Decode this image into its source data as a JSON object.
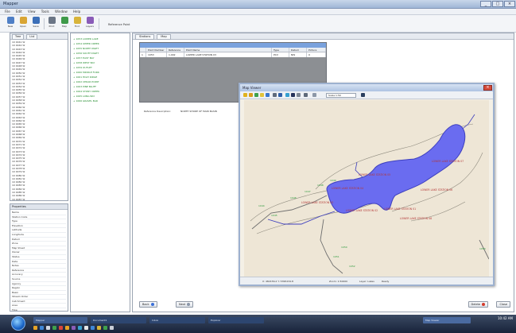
{
  "window": {
    "title": "Mapper",
    "buttons": [
      "_",
      "□",
      "×"
    ]
  },
  "menu": [
    "File",
    "Edit",
    "View",
    "Tools",
    "Window",
    "Help"
  ],
  "toolbar": {
    "buttons": [
      {
        "label": "New",
        "icon": "new-icon",
        "color": "#4f7fc6"
      },
      {
        "label": "Open",
        "icon": "open-icon",
        "color": "#d9a534"
      },
      {
        "label": "Save",
        "icon": "save-icon",
        "color": "#3c6fb8"
      },
      {
        "label": "Print",
        "icon": "print-icon",
        "color": "#6b7686"
      },
      {
        "label": "Map",
        "icon": "map-icon",
        "color": "#3f9a4a"
      },
      {
        "label": "Find",
        "icon": "find-icon",
        "color": "#d8b43a"
      },
      {
        "label": "Layers",
        "icon": "layers-icon",
        "color": "#8a5cb8"
      }
    ],
    "extra_label": "Reference Point"
  },
  "left_tree": {
    "tabs": [
      "Tree",
      "List"
    ],
    "items": [
      "10 0041 W",
      "10 0042 W",
      "10 0043 W",
      "10 0044 W",
      "10 0045 W",
      "10 0046 W",
      "10 0047 W",
      "10 0048 W",
      "10 0049 W",
      "10 0050 W",
      "10 0051 W",
      "10 0052 W",
      "10 0053 W",
      "10 0054 W",
      "10 0055 W",
      "10 0056 W",
      "10 0057 W",
      "10 0058 W",
      "10 0059 W",
      "10 0060 W",
      "10 0061 W",
      "10 0062 W",
      "10 0063 W",
      "10 0064 W",
      "10 0065 W",
      "10 0066 W",
      "10 0067 W",
      "10 0068 W",
      "10 0069 W",
      "10 0070 W",
      "10 0071 W",
      "10 0072 W",
      "10 0073 W",
      "10 0074 W",
      "10 0075 W",
      "10 0076 W",
      "10 0077 W",
      "10 0078 W",
      "10 0079 W",
      "10 0080 W",
      "10 0081 W",
      "10 0082 W",
      "10 0083 W",
      "10 0084 W",
      "10 0085 W",
      "10 0086 W",
      "10 0087 W",
      "10 0088 W"
    ],
    "selected_index": 47
  },
  "left_props": {
    "title": "Properties",
    "items": [
      "Name",
      "Station Code",
      "Type",
      "Elevation",
      "Latitude",
      "Longitude",
      "Datum",
      "Zone",
      "Map Sheet",
      "Owner",
      "Status",
      "Date",
      "Notes",
      "Reference",
      "Accuracy",
      "Source",
      "Agency",
      "Region",
      "Basin",
      "Stream Order",
      "Catchment",
      "Area",
      "Flow",
      "Gauge"
    ]
  },
  "green_list": {
    "items": [
      "+ 1053 LOWER LAKE",
      "+ 1054 UPPER CREEK",
      "+ 1055 NORTH INLET",
      "+ 1056 SOUTH INLET",
      "+ 1057 EAST BAY",
      "+ 1058 WEST BAY",
      "+ 1059 OUTLET",
      "+ 1060 MIDDLE FORK",
      "+ 1061 HIGH RIDGE",
      "+ 1062 CEDAR POINT",
      "+ 1063 PINE BLUFF",
      "+ 1064 STONY CREEK",
      "+ 1065 LONG BAY",
      "+ 1066 GRAVEL BAR"
    ]
  },
  "main": {
    "tabs": [
      "Stations",
      "Map"
    ],
    "grid": {
      "columns": [
        "",
        "Point Number",
        "Reference",
        "Point Name",
        "Type",
        "Datum",
        "Picture"
      ],
      "rows": [
        [
          "1",
          "1053",
          "1,002",
          "LOWER LAKE STATION 03",
          "PCV",
          "NW",
          "0"
        ]
      ]
    },
    "reference_label": "Reference Description:",
    "reference_value": "NORTH SHORE OF MAIN BASIN",
    "bottom_left_buttons": [
      "Back",
      "Next"
    ],
    "bottom_right_buttons": [
      "Delete",
      "Close"
    ]
  },
  "map_window": {
    "title": "Map Viewer",
    "close": "×",
    "combo_value": "Scale 1:50",
    "status": [
      "X: 482156.2 Y: 5395234.8",
      "Zoom: 1:50000",
      "Layer: Lakes",
      "Ready"
    ],
    "colors": {
      "lake": "#6a6cf0",
      "lake_outline": "#3d3fbe",
      "water_line": "#3d3fbe",
      "road": "#6f6f6f",
      "contour": "#8e8a7e",
      "label": "#b33636",
      "marker": "#2b9a3b",
      "canvas": "#eee6d6"
    },
    "labels": [
      "LOWER LAKE STATION 07",
      "LOWER LAKE STATION 05",
      "LOWER LAKE STATION 04",
      "LOWER LAKE STATION 03",
      "LOWER LAKE STATION 02",
      "LOWER LAKE STATION 01",
      "LOWER LAKE STATION 06",
      "LOWER LAKE STATION 08"
    ],
    "markers": [
      "1044",
      "1045",
      "1046",
      "1047",
      "1048",
      "1049",
      "1050",
      "1051",
      "1052",
      "1053"
    ]
  },
  "taskbar": {
    "apps": [
      "Mapper",
      "Document1",
      "Inbox",
      "Explorer",
      "Map Viewer"
    ],
    "time": "10:42 AM"
  }
}
